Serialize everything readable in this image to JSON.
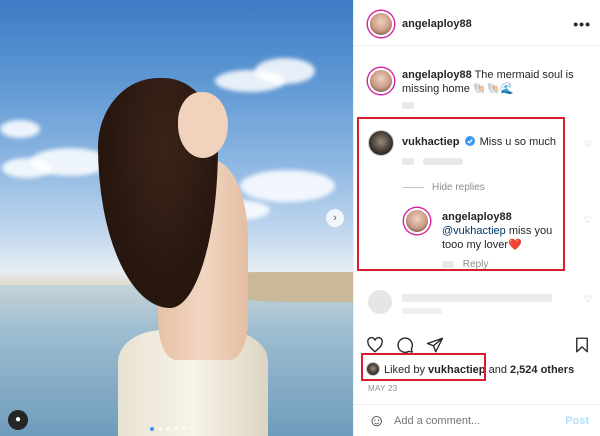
{
  "post": {
    "author": "angelaploy88",
    "caption": "The mermaid soul is missing home",
    "caption_emoji": "🐚🐚🌊"
  },
  "comments": [
    {
      "username": "vukhactiep",
      "verified": true,
      "text": "Miss u so much",
      "hide_replies": "Hide replies"
    },
    {
      "username": "angelaploy88",
      "mention": "@vukhactiep",
      "text": "miss you tooo my lover",
      "emoji": "❤️",
      "reply": "Reply"
    }
  ],
  "likes": {
    "prefix": "Liked by",
    "user": "vukhactiep",
    "joiner": "and",
    "count": "2,524 others"
  },
  "date": "MAY 23",
  "composer": {
    "placeholder": "Add a comment...",
    "post_label": "Post",
    "emoji_icon": "☺"
  },
  "icons": {
    "more": "•••",
    "next": "›",
    "heart": "♡",
    "user_tag": "●",
    "like_heart": "heart-icon",
    "comment": "comment-icon",
    "share": "share-icon",
    "save": "bookmark-icon"
  },
  "colors": {
    "highlight": "#d61f2c",
    "link": "#00376b",
    "post_button": "#b2dffc"
  }
}
